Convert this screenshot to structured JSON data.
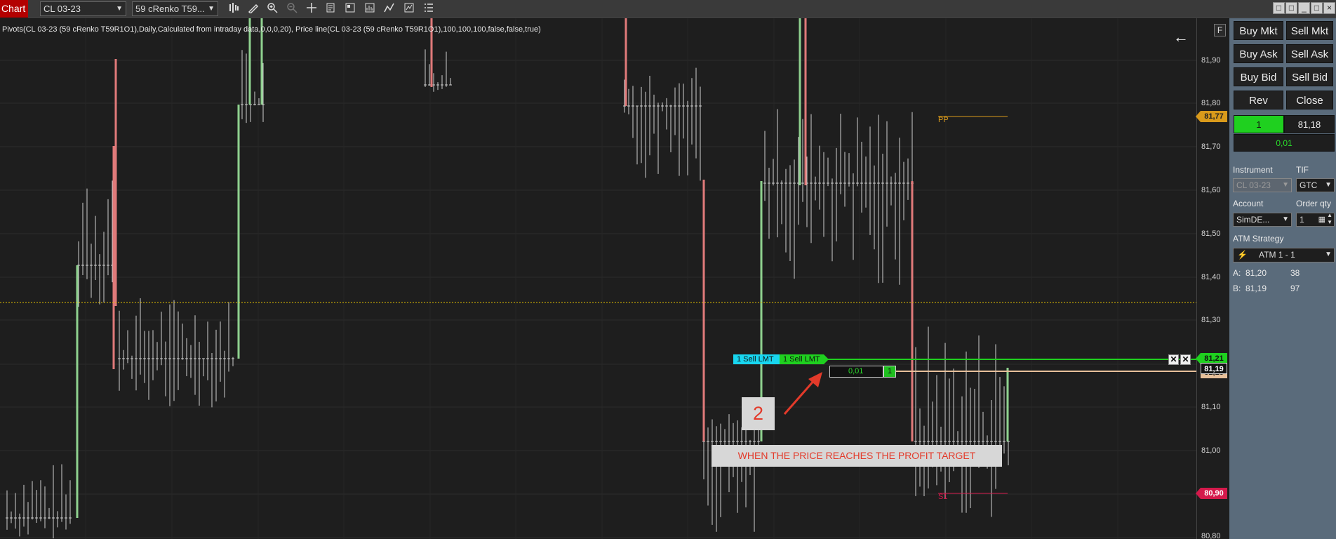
{
  "toolbar": {
    "chart_tab": "Chart",
    "instrument": "CL 03-23",
    "bar_type": "59 cRenko T59...",
    "icons": [
      "bar-type-icon",
      "draw-tools-icon",
      "zoom-in-icon",
      "zoom-out-icon",
      "crosshair-icon",
      "properties-icon",
      "templates-icon",
      "data-box-icon",
      "strategies-icon",
      "indicators-icon",
      "instrument-list-icon"
    ],
    "window_buttons": [
      "□",
      "□",
      "_",
      "□",
      "×"
    ]
  },
  "chart": {
    "indicator_label": "Pivots(CL 03-23 (59 cRenko T59R1O1),Daily,Calculated from intraday data,0,0,0,20), Price line(CL 03-23 (59 cRenko T59R1O1),100,100,100,false,false,true)",
    "back_arrow": "←",
    "pp_label": "PP",
    "s1_label": "S1",
    "order_tag_1": "1  Sell LMT",
    "order_tag_2": "1  Sell LMT",
    "position_pnl": "0,01",
    "position_qty": "1",
    "close_x": "✕",
    "annotation_number": "2",
    "annotation_text": "WHEN THE PRICE REACHES THE PROFIT TARGET",
    "colors": {
      "up": "#8fd18f",
      "down": "#e07a7a",
      "wick": "#d0d0d0",
      "target": "#1fd01f",
      "price_line": "#e5c300",
      "pp": "#d99a1b",
      "s1": "#d4194b"
    }
  },
  "axis": {
    "f_button": "F",
    "ticks": [
      "81,90",
      "81,80",
      "81,70",
      "81,60",
      "81,50",
      "81,40",
      "81,30",
      "81,10",
      "81,00",
      "80,80"
    ],
    "pp_badge": "81,77",
    "target_badge": "81,21",
    "last_badge": "81,19",
    "peach_badge": "81,18",
    "s1_badge": "80,90"
  },
  "panel": {
    "buttons": [
      "Buy Mkt",
      "Sell Mkt",
      "Buy Ask",
      "Sell Ask",
      "Buy Bid",
      "Sell Bid",
      "Rev",
      "Close"
    ],
    "position_qty": "1",
    "position_price": "81,18",
    "pnl": "0,01",
    "instrument_label": "Instrument",
    "tif_label": "TIF",
    "instrument_value": "CL 03-23",
    "tif_value": "GTC",
    "account_label": "Account",
    "order_qty_label": "Order qty",
    "account_value": "SimDE...",
    "order_qty_value": "1",
    "atm_label": "ATM Strategy",
    "atm_value": "ATM 1 - 1",
    "ask_label": "A:",
    "ask_price": "81,20",
    "ask_size": "38",
    "bid_label": "B:",
    "bid_price": "81,19",
    "bid_size": "97"
  }
}
